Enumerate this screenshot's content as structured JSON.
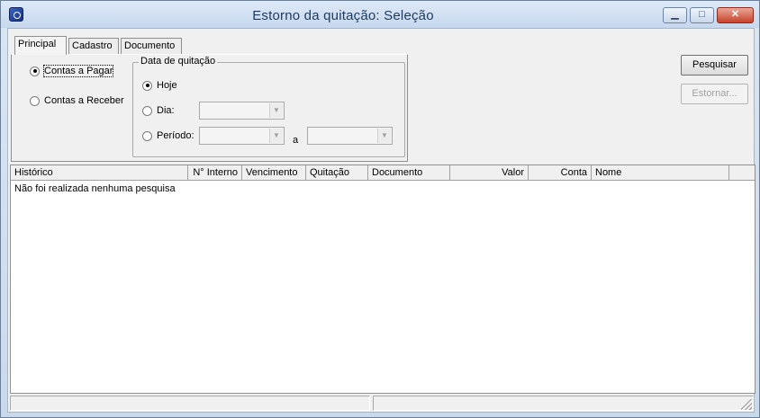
{
  "window": {
    "title": "Estorno da quitação: Seleção",
    "controls": {
      "minimize": "▁",
      "maximize": "□",
      "close": "✕"
    }
  },
  "tabs": [
    {
      "label": "Principal",
      "active": true
    },
    {
      "label": "Cadastro",
      "active": false
    },
    {
      "label": "Documento",
      "active": false
    }
  ],
  "account_type": {
    "options": [
      {
        "label": "Contas a Pagar",
        "checked": true
      },
      {
        "label": "Contas a Receber",
        "checked": false
      }
    ]
  },
  "date_group": {
    "title": "Data de quitação",
    "hoje": {
      "label": "Hoje",
      "checked": true
    },
    "dia": {
      "label": "Dia:",
      "checked": false,
      "value": ""
    },
    "periodo": {
      "label": "Período:",
      "checked": false,
      "from": "",
      "to": "",
      "separator": "a"
    }
  },
  "buttons": {
    "pesquisar": "Pesquisar",
    "estornar": "Estornar..."
  },
  "grid": {
    "columns": [
      "Histórico",
      "N° Interno",
      "Vencimento",
      "Quitação",
      "Documento",
      "Valor",
      "Conta",
      "Nome"
    ],
    "empty_message": "Não foi realizada nenhuma pesquisa"
  },
  "statusbar": {
    "panes": [
      "",
      ""
    ]
  }
}
